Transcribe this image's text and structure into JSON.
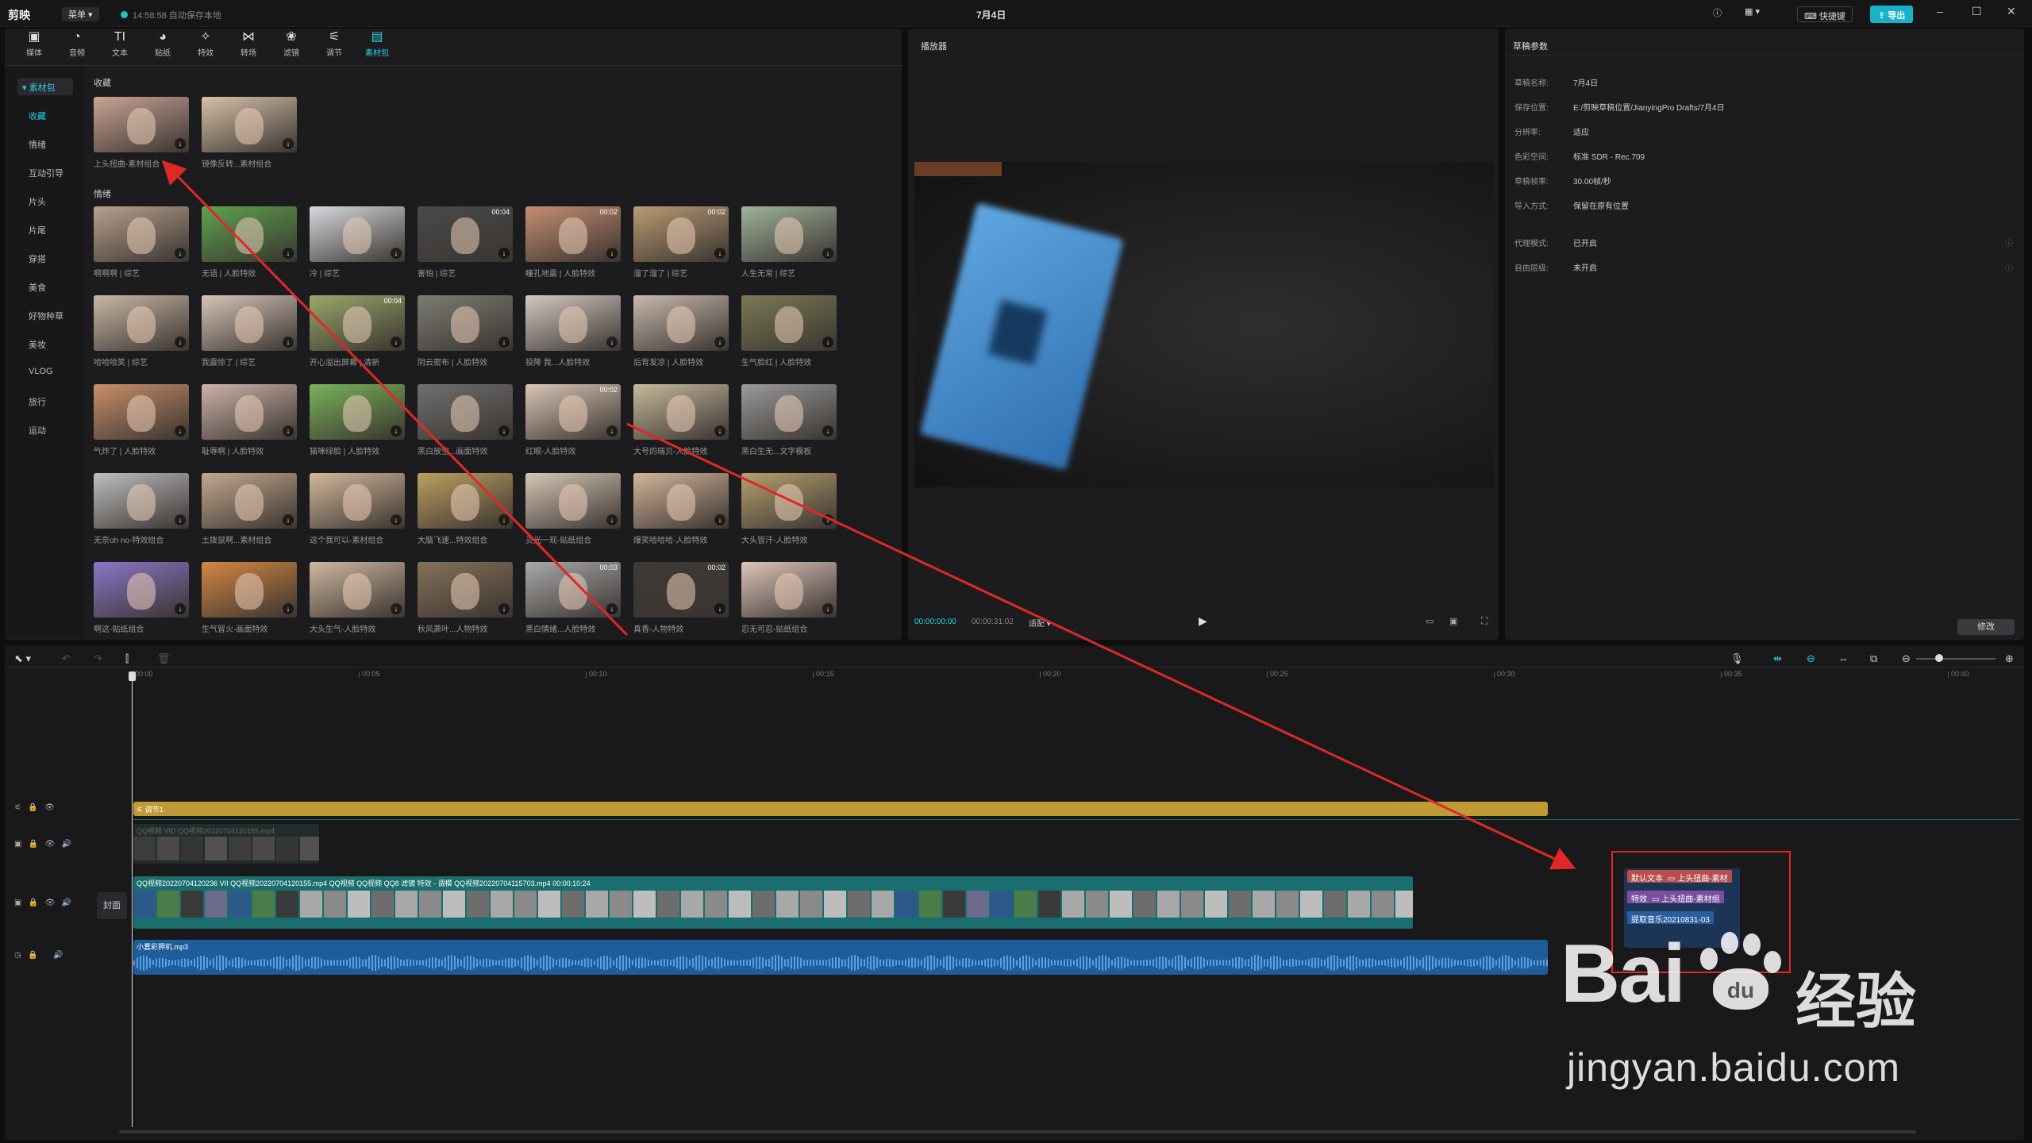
{
  "titlebar": {
    "logo": "剪映",
    "menu": "菜单",
    "autosave": "14:58:58 自动保存本地",
    "title": "7月4日",
    "shortcut": "快捷键",
    "export": "导出"
  },
  "toolbar": [
    {
      "icon": "media-icon",
      "glyph": "▣",
      "label": "媒体"
    },
    {
      "icon": "audio-icon",
      "glyph": "◔",
      "label": "音频"
    },
    {
      "icon": "text-icon",
      "glyph": "TI",
      "label": "文本"
    },
    {
      "icon": "sticker-icon",
      "glyph": "◕",
      "label": "贴纸"
    },
    {
      "icon": "effects-icon",
      "glyph": "✧",
      "label": "特效"
    },
    {
      "icon": "transition-icon",
      "glyph": "⋈",
      "label": "转场"
    },
    {
      "icon": "filter-icon",
      "glyph": "❀",
      "label": "滤镜"
    },
    {
      "icon": "adjust-icon",
      "glyph": "⚟",
      "label": "调节"
    },
    {
      "icon": "material-pack-icon",
      "glyph": "▤",
      "label": "素材包"
    }
  ],
  "leftnav": {
    "head": "素材包",
    "items": [
      "收藏",
      "情绪",
      "互动引导",
      "片头",
      "片尾",
      "穿搭",
      "美食",
      "好物种草",
      "美妆",
      "VLOG",
      "旅行",
      "运动"
    ]
  },
  "library": {
    "section_fav": "收藏",
    "section_mood": "情绪",
    "favorites": [
      {
        "caption": "上头扭曲-素材组合",
        "color": "#c9a493"
      },
      {
        "caption": "镜像反转...素材组合",
        "color": "#d6c1a8"
      }
    ],
    "items": [
      {
        "caption": "啊啊啊 | 综艺",
        "color": "#b7a08e",
        "time": ""
      },
      {
        "caption": "无语 | 人脸特效",
        "color": "#5ea34d",
        "time": ""
      },
      {
        "caption": "冷 | 综艺",
        "color": "#d8dadf",
        "time": ""
      },
      {
        "caption": "害怕 | 综艺",
        "color": "#4a4a4a",
        "time": "00:04"
      },
      {
        "caption": "瞳孔地震 | 人脸特效",
        "color": "#c58e73",
        "time": "00:02"
      },
      {
        "caption": "溜了溜了 | 综艺",
        "color": "#b99b73",
        "time": "00:02"
      },
      {
        "caption": "人生无常 | 综艺",
        "color": "#9fb39a",
        "time": ""
      },
      {
        "caption": "哈哈哈笑 | 综艺",
        "color": "#c9b7a5",
        "time": ""
      },
      {
        "caption": "我震惊了 | 综艺",
        "color": "#d7c4b8",
        "time": ""
      },
      {
        "caption": "开心溢出屏幕 | 清新",
        "color": "#9aa86b",
        "time": "00:04"
      },
      {
        "caption": "阴云密布 | 人脸特效",
        "color": "#7d7d74",
        "time": ""
      },
      {
        "caption": "投降 我...人脸特效",
        "color": "#d3c9c2",
        "time": ""
      },
      {
        "caption": "后背发凉 | 人脸特效",
        "color": "#c7b9ac",
        "time": ""
      },
      {
        "caption": "生气脸红 | 人脸特效",
        "color": "#7a7a55",
        "time": ""
      },
      {
        "caption": "气炸了 | 人脸特效",
        "color": "#c98f6a",
        "time": ""
      },
      {
        "caption": "耻辱啊 | 人脸特效",
        "color": "#cdb3a8",
        "time": ""
      },
      {
        "caption": "猫咪绿脸 | 人脸特效",
        "color": "#7ab35a",
        "time": ""
      },
      {
        "caption": "黑白放空...画面特效",
        "color": "#707070",
        "time": ""
      },
      {
        "caption": "红眼-人脸特效",
        "color": "#d9c6b6",
        "time": "00:02"
      },
      {
        "caption": "大号的瑞贝-人脸特效",
        "color": "#c6b99c",
        "time": ""
      },
      {
        "caption": "黑白生无...文字模板",
        "color": "#9a9a9a",
        "time": ""
      },
      {
        "caption": "无奈oh no-特效组合",
        "color": "#bfbfbf",
        "time": ""
      },
      {
        "caption": "土拨鼠啊...素材组合",
        "color": "#c4a88e",
        "time": ""
      },
      {
        "caption": "这个我可以-素材组合",
        "color": "#d3b89c",
        "time": ""
      },
      {
        "caption": "大脑飞速...特效组合",
        "color": "#bca061",
        "time": ""
      },
      {
        "caption": "灵光一现-贴纸组合",
        "color": "#d6c6b6",
        "time": ""
      },
      {
        "caption": "爆笑哈哈哈-人脸特效",
        "color": "#d3b59a",
        "time": ""
      },
      {
        "caption": "大头冒汗-人脸特效",
        "color": "#b5a06f",
        "time": ""
      },
      {
        "caption": "啊这-贴纸组合",
        "color": "#8b77c9",
        "time": ""
      },
      {
        "caption": "生气冒火-画面特效",
        "color": "#d48743",
        "time": ""
      },
      {
        "caption": "大头生气-人脸特效",
        "color": "#cfb8a1",
        "time": ""
      },
      {
        "caption": "秋风萧叶...人物特效",
        "color": "#857259",
        "time": ""
      },
      {
        "caption": "黑白情绪...人脸特效",
        "color": "#a9a9a9",
        "time": "00:03"
      },
      {
        "caption": "真香-人物特效",
        "color": "#3e3a36",
        "time": "00:02"
      },
      {
        "caption": "忍无可忍-贴纸组合",
        "color": "#dcc5b9",
        "time": ""
      }
    ]
  },
  "player": {
    "title": "播放器",
    "time_current": "00:00:00:00",
    "time_total": "00:00:31:02",
    "ratio": "适配"
  },
  "draft": {
    "title": "草稿参数",
    "rows": [
      {
        "k": "草稿名称:",
        "v": "7月4日"
      },
      {
        "k": "保存位置:",
        "v": "E:/剪映草稿位置/JianyingPro Drafts/7月4日"
      },
      {
        "k": "分辨率:",
        "v": "适应"
      },
      {
        "k": "色彩空间:",
        "v": "标准 SDR - Rec.709"
      },
      {
        "k": "草稿帧率:",
        "v": "30.00帧/秒"
      },
      {
        "k": "导入方式:",
        "v": "保留在原有位置"
      },
      {
        "k": "代理模式:",
        "v": "已开启"
      },
      {
        "k": "自由层级:",
        "v": "未开启"
      }
    ],
    "modify": "修改"
  },
  "timeline": {
    "ruler": [
      "00:00",
      "00:05",
      "00:10",
      "00:15",
      "00:20",
      "00:25",
      "00:30",
      "00:35",
      "00:40"
    ],
    "adjust_label": "调节1",
    "overlay_label": "QQ视频 VID  QQ视频20220704120155.mp4",
    "main_label": "QQ视频20220704120236 VII  QQ视频20220704120155.mp4  QQ视频 QQ视频 QQ8  滤镜  特效 - 调模  QQ视频20220704115703.mp4  00:00:10:24",
    "cover": "封面",
    "audio_label": "小蠢彩狎机.mp3"
  },
  "callout": {
    "tags": [
      {
        "a": "默认文本",
        "b": "上头扭曲-素材",
        "color": "#b84e4e"
      },
      {
        "a": "特效",
        "b": "上头扭曲-素材组",
        "color": "#7a4fa0"
      },
      {
        "a": "提取音乐20210831-03",
        "b": "",
        "color": "#2a5e9f"
      }
    ]
  },
  "watermark": {
    "brand": "Bai",
    "paw": "du",
    "cn": "经验",
    "url": "jingyan.baidu.com"
  },
  "colors": {
    "accent": "#29d0e0",
    "adjust": "#c09a34",
    "main_track": "#1a6e6e",
    "audio": "#2060a0",
    "arrow": "#e02828"
  }
}
